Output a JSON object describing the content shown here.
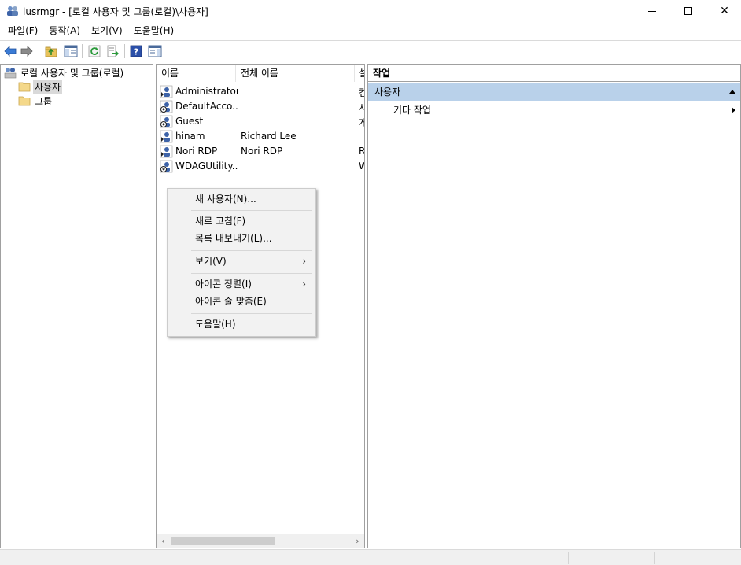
{
  "window": {
    "title": "lusrmgr - [로컬 사용자 및 그룹(로컬)\\사용자]",
    "minimize_icon": "minimize-icon",
    "maximize_icon": "maximize-icon",
    "close_symbol": "✕"
  },
  "menubar": {
    "items": [
      "파일(F)",
      "동작(A)",
      "보기(V)",
      "도움말(H)"
    ]
  },
  "toolbar": {
    "buttons": [
      "back-arrow-icon",
      "forward-arrow-icon",
      "up-folder-icon",
      "show-hide-tree-icon",
      "refresh-icon",
      "export-list-icon",
      "help-icon",
      "show-hide-action-pane-icon"
    ]
  },
  "tree": {
    "root": "로컬 사용자 및 그룹(로컬)",
    "children": [
      "사용자",
      "그룹"
    ],
    "selected": "사용자"
  },
  "list": {
    "columns": [
      "이름",
      "전체 이름",
      "설"
    ],
    "rows": [
      {
        "name": "Administrator",
        "full_name": "",
        "desc": "컴"
      },
      {
        "name": "DefaultAcco...",
        "full_name": "",
        "desc": "시"
      },
      {
        "name": "Guest",
        "full_name": "",
        "desc": "게"
      },
      {
        "name": "hinam",
        "full_name": "Richard Lee",
        "desc": ""
      },
      {
        "name": "Nori RDP",
        "full_name": "Nori RDP",
        "desc": "R"
      },
      {
        "name": "WDAGUtility...",
        "full_name": "",
        "desc": "W"
      }
    ],
    "scroll_left": "‹",
    "scroll_right": "›"
  },
  "actions": {
    "header": "작업",
    "section": "사용자",
    "items": [
      "기타 작업"
    ]
  },
  "context_menu": {
    "items": {
      "new_user": "새 사용자(N)...",
      "refresh": "새로 고침(F)",
      "export_list": "목록 내보내기(L)...",
      "view": "보기(V)",
      "arrange_icons": "아이콘 정렬(I)",
      "line_up_icons": "아이콘 줄 맞춤(E)",
      "help": "도움말(H)"
    },
    "submenu_arrow": "›"
  },
  "colors": {
    "accent_section": "#b9d1ea",
    "selection": "#d9d9d9",
    "status_bar": "#f0f0f0"
  }
}
